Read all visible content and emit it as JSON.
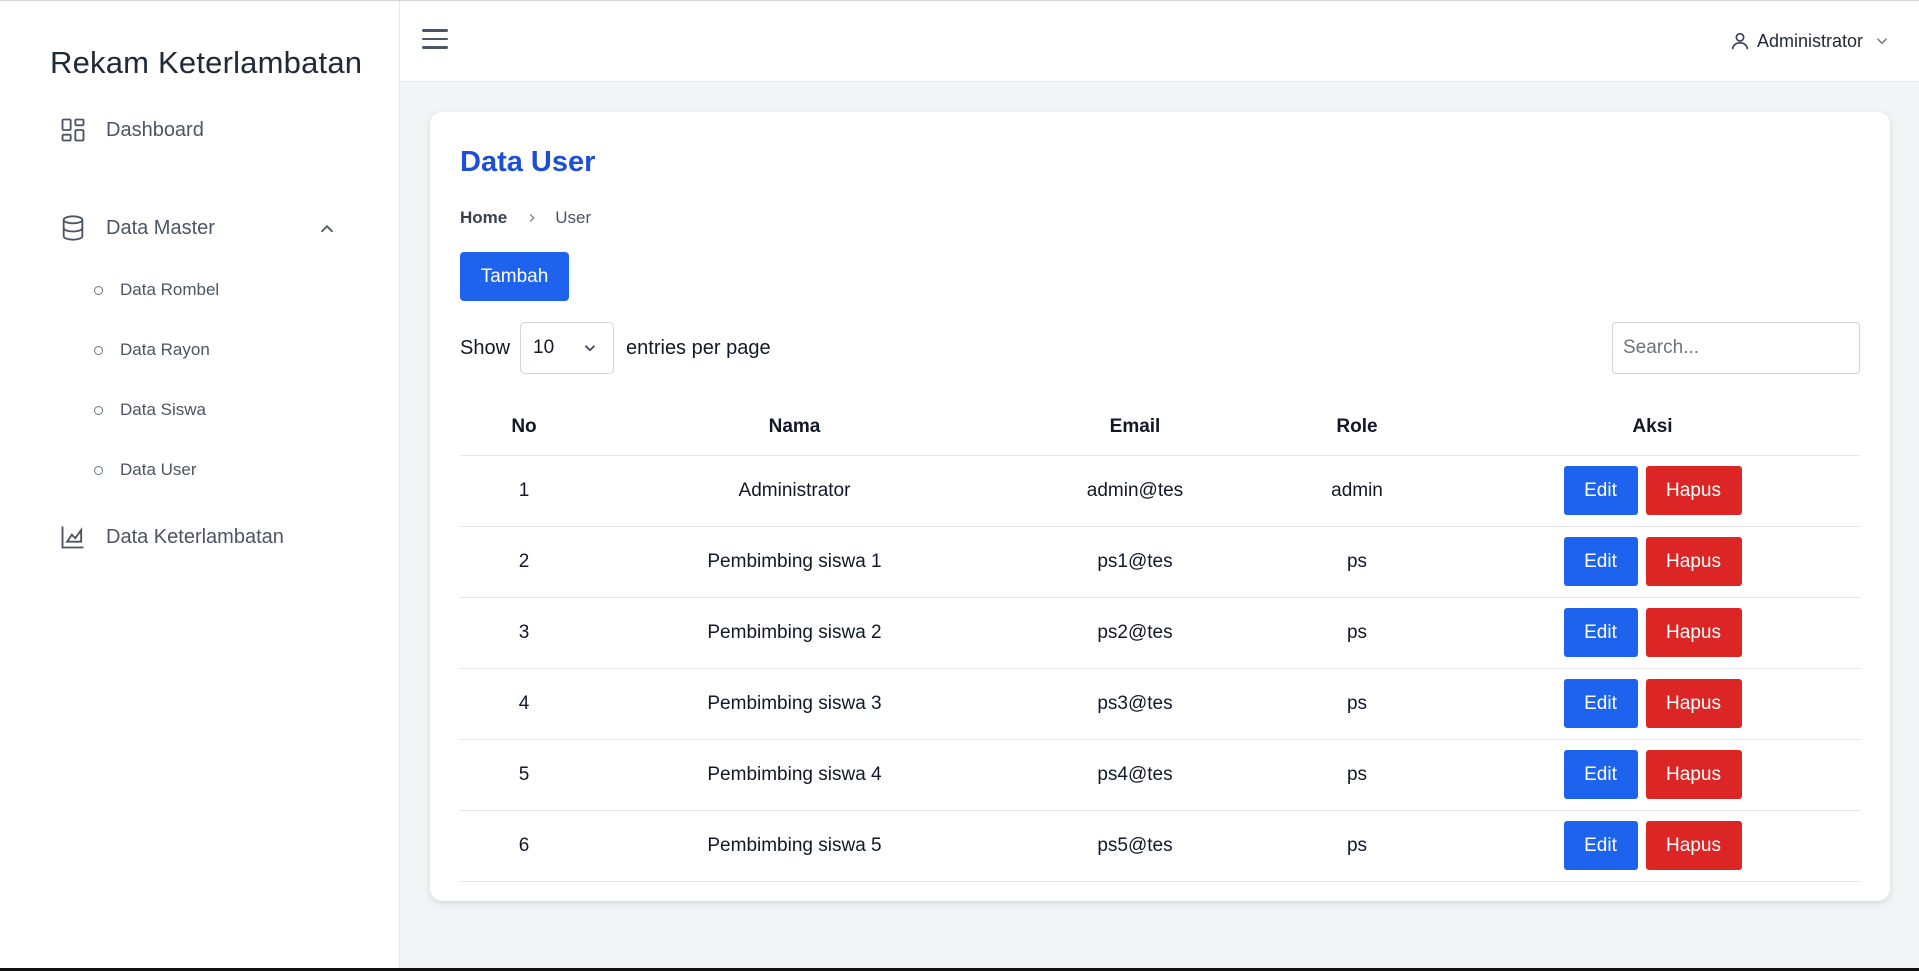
{
  "app": {
    "brand": "Rekam Keterlambatan"
  },
  "sidebar": {
    "items": [
      {
        "label": "Dashboard",
        "icon": "dashboard-grid-icon"
      },
      {
        "label": "Data Master",
        "icon": "database-icon",
        "expanded": true,
        "children": [
          {
            "label": "Data Rombel"
          },
          {
            "label": "Data Rayon"
          },
          {
            "label": "Data Siswa"
          },
          {
            "label": "Data User"
          }
        ]
      },
      {
        "label": "Data Keterlambatan",
        "icon": "chart-area-icon"
      }
    ]
  },
  "header": {
    "user_name": "Administrator"
  },
  "page": {
    "title": "Data User",
    "breadcrumb": {
      "home": "Home",
      "current": "User"
    },
    "add_button": "Tambah",
    "show_label": "Show",
    "entries_value": "10",
    "entries_suffix": "entries per page",
    "search_placeholder": "Search..."
  },
  "table": {
    "columns": [
      "No",
      "Nama",
      "Email",
      "Role",
      "Aksi"
    ],
    "edit_label": "Edit",
    "delete_label": "Hapus",
    "rows": [
      {
        "no": "1",
        "nama": "Administrator",
        "email": "admin@tes",
        "role": "admin"
      },
      {
        "no": "2",
        "nama": "Pembimbing siswa 1",
        "email": "ps1@tes",
        "role": "ps"
      },
      {
        "no": "3",
        "nama": "Pembimbing siswa 2",
        "email": "ps2@tes",
        "role": "ps"
      },
      {
        "no": "4",
        "nama": "Pembimbing siswa 3",
        "email": "ps3@tes",
        "role": "ps"
      },
      {
        "no": "5",
        "nama": "Pembimbing siswa 4",
        "email": "ps4@tes",
        "role": "ps"
      },
      {
        "no": "6",
        "nama": "Pembimbing siswa 5",
        "email": "ps5@tes",
        "role": "ps"
      }
    ]
  },
  "colors": {
    "primary": "#1d63ed",
    "danger": "#dc2626",
    "title": "#1d4ed8"
  }
}
